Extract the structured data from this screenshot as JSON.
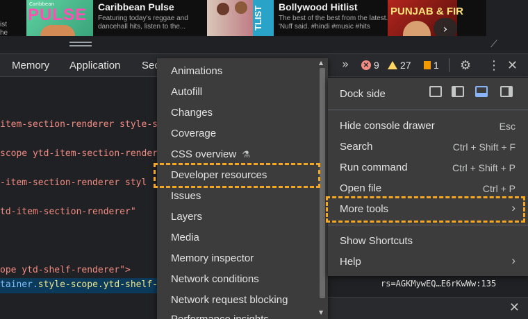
{
  "cards": [
    {
      "title": "Caribbean Pulse",
      "desc_1": "Featuring today's reggae and",
      "desc_2": "dancehall hits, listen to the...",
      "thumb_text": "PULSE",
      "thumb_sub": "Caribbean"
    },
    {
      "title": "Bollywood Hitlist",
      "desc_1": "The best of the best from the latest.",
      "desc_2": "'Nuff said. #hindi #music #hits",
      "thumb_text": "TLIST"
    },
    {
      "thumb_text": "PUNJAB & FIR"
    }
  ],
  "card_left_fragments": [
    "ist",
    "he"
  ],
  "tabs": {
    "memory": "Memory",
    "application": "Application",
    "sec": "Sec"
  },
  "status": {
    "overflow": "»",
    "errors": "9",
    "warnings": "27",
    "issues": "1"
  },
  "icons": {
    "settings": "⚙",
    "more": "⋮",
    "close": "✕"
  },
  "code_lines": [
    "item-section-renderer style-s",
    "scope ytd-item-section-render",
    "-item-section-renderer styl",
    "td-item-section-renderer\"",
    "ope ytd-shelf-renderer\">"
  ],
  "selected_line": {
    "prefix": "tainer.",
    "rest": "style-scope.ytd-shelf-render"
  },
  "submenu": [
    "Animations",
    "Autofill",
    "Changes",
    "Coverage",
    "CSS overview",
    "Developer resources",
    "Issues",
    "Layers",
    "Media",
    "Memory inspector",
    "Network conditions",
    "Network request blocking",
    "Performance insights"
  ],
  "menu": {
    "dock_side": "Dock side",
    "hide_console": {
      "label": "Hide console drawer",
      "shortcut": "Esc"
    },
    "search": {
      "label": "Search",
      "shortcut": "Ctrl + Shift + F"
    },
    "run_command": {
      "label": "Run command",
      "shortcut": "Ctrl + Shift + P"
    },
    "open_file": {
      "label": "Open file",
      "shortcut": "Ctrl + P"
    },
    "more_tools": "More tools",
    "show_shortcuts": "Show Shortcuts",
    "help": "Help"
  },
  "console_line": "rs=AGKMywEQ…E6rKwWw:135",
  "colors": {
    "highlight": "#f5a623",
    "menu_bg": "#3c3c3c",
    "dock_active": "#8ab4f8"
  }
}
